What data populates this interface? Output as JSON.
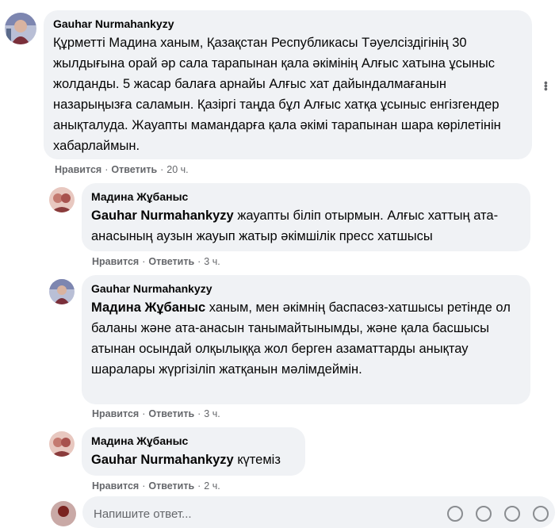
{
  "comments": [
    {
      "author": "Gauhar Nurmahankyzy",
      "text": "Құрметті Мадина ханым, Қазақстан Республикасы Тәуелсіздігінің 30 жылдығына орай әр сала тарапынан қала әкімінің Алғыс хатына ұсыныс жолданды. 5 жасар балаға арнайы Алғыс хат дайындалмағанын назарыңызға саламын. Қазіргі таңда бұл Алғыс хатқа ұсыныс енгізгендер анықталуда. Жауапты мамандарға қала әкімі тарапынан шара көрілетінін хабарлаймын.",
      "like": "Нравится",
      "reply": "Ответить",
      "time": "20 ч."
    },
    {
      "author": "Мадина Жұбаныс",
      "mention": "Gauhar Nurmahankyzy",
      "text": " жауапты біліп отырмын. Алғыс хаттың ата-анасының аузын жауып жатыр әкімшілік пресс хатшысы",
      "like": "Нравится",
      "reply": "Ответить",
      "time": "3 ч."
    },
    {
      "author": "Gauhar Nurmahankyzy",
      "mention": "Мадина Жұбаныс",
      "text": " ханым, мен әкімнің баспасөз-хатшысы ретінде ол баланы және ата-анасын танымайтынымды, және қала басшысы атынан осындай олқылыққа жол берген азаматтарды анықтау шаралары жүргізіліп жатқанын мәлімдеймін.",
      "like": "Нравится",
      "reply": "Ответить",
      "time": "3 ч."
    },
    {
      "author": "Мадина Жұбаныс",
      "mention": "Gauhar Nurmahankyzy",
      "text": " күтеміз",
      "like": "Нравится",
      "reply": "Ответить",
      "time": "2 ч."
    }
  ],
  "reply_box": {
    "placeholder": "Напишите ответ..."
  },
  "more_icon": "more-dots-icon",
  "colors": {
    "bubble": "#f0f2f5",
    "muted": "#65676b",
    "text": "#050505"
  }
}
